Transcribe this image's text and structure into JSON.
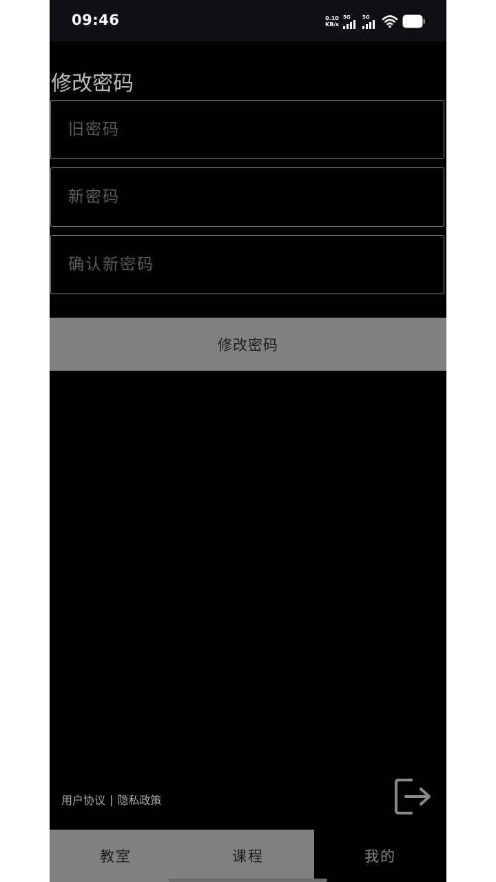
{
  "status_bar": {
    "time": "09:46",
    "net_speed_value": "0.10",
    "net_speed_unit": "KB/s",
    "signal1_label": "5G",
    "signal2_label": "5G",
    "wifi_icon": "wifi-icon",
    "battery_icon": "battery-icon"
  },
  "page": {
    "title": "修改密码"
  },
  "form": {
    "old_password_placeholder": "旧密码",
    "old_password_value": "",
    "new_password_placeholder": "新密码",
    "new_password_value": "",
    "confirm_password_placeholder": "确认新密码",
    "confirm_password_value": "",
    "submit_label": "修改密码"
  },
  "footer": {
    "user_agreement": "用户协议",
    "separator": "|",
    "privacy_policy": "隐私政策",
    "logout_icon": "logout-icon"
  },
  "tabbar": {
    "tabs": [
      {
        "label": "教室",
        "active": false
      },
      {
        "label": "课程",
        "active": false
      },
      {
        "label": "我的",
        "active": true
      }
    ]
  },
  "colors": {
    "background": "#000000",
    "tab_inactive_bg": "#808080",
    "button_bg": "#808080",
    "field_border": "#8a8a8a"
  }
}
